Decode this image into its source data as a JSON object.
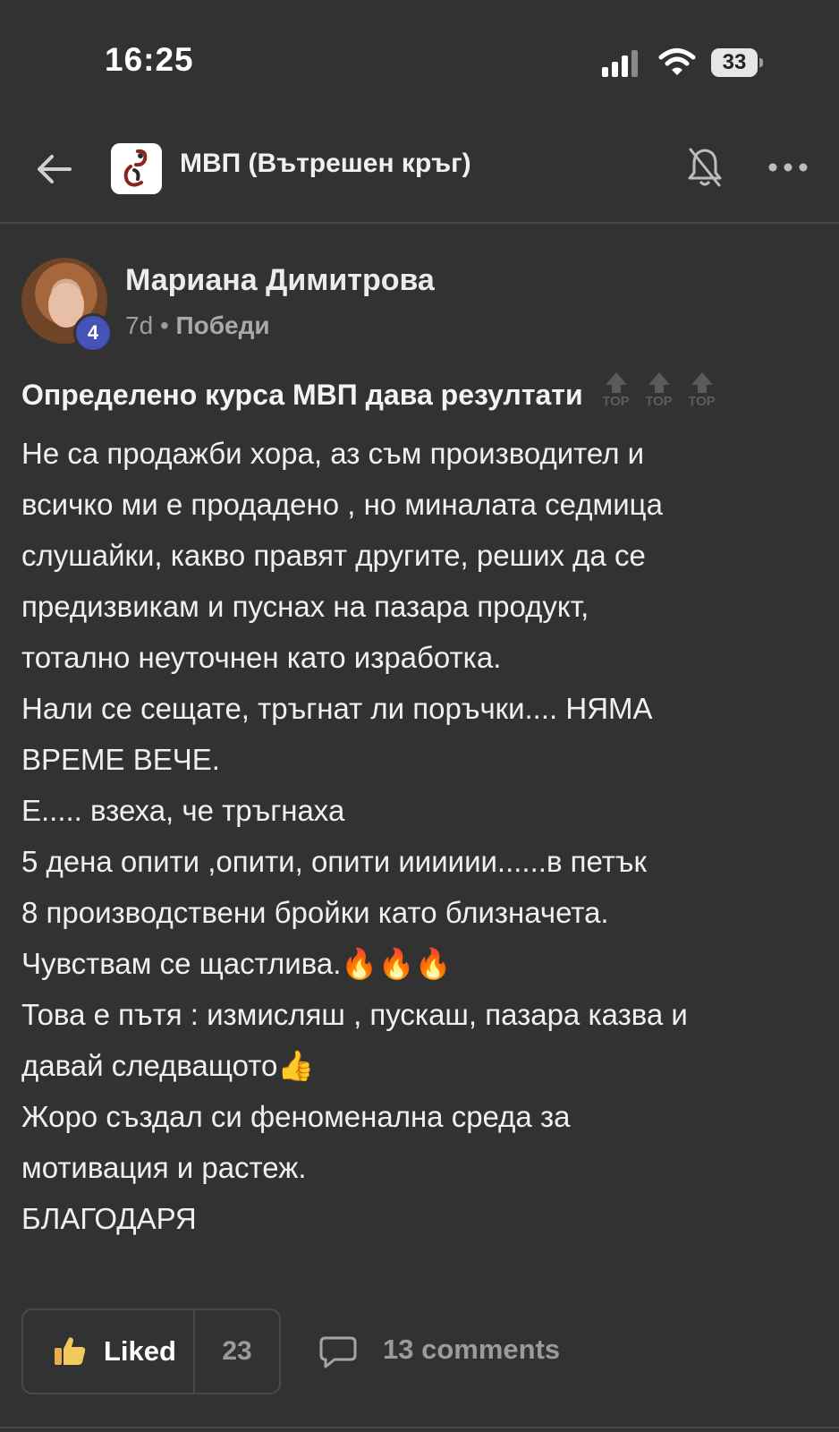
{
  "status_bar": {
    "time": "16:25",
    "battery": "33"
  },
  "header": {
    "group_name": "МВП (Вътрешен кръг)"
  },
  "post": {
    "author": "Мариана Димитрова",
    "level": "4",
    "age": "7d",
    "separator": "•",
    "category": "Победи",
    "title": "Определено курса МВП дава резултати",
    "top_badge_text": "TOP",
    "body_lines": [
      "Не са продажби хора, аз съм производител и",
      "всичко ми е продадено , но миналата седмица",
      "слушайки, какво правят другите, реших да се",
      "предизвикам и пуснах на пазара продукт,",
      "тотално неуточнен като изработка.",
      "Нали се сещате, тръгнат ли поръчки.... НЯМА",
      "ВРЕМЕ ВЕЧЕ.",
      "Е..... взеха, че тръгнаха",
      "5 дена опити ,опити, опити ииииии......в петък",
      "8 производствени бройки като близначета.",
      "Чувствам се щастлива.🔥🔥🔥",
      "Това е пътя : измисляш , пускаш, пазара казва и",
      "давай следващото👍",
      "Жоро създал си феноменална среда за",
      "мотивация и растеж.",
      "БЛАГОДАРЯ"
    ]
  },
  "actions": {
    "liked_label": "Liked",
    "like_count": "23",
    "comments_label": "13 comments"
  },
  "icons": [
    "back-arrow-icon",
    "group-logo-icon",
    "bell-off-icon",
    "more-icon",
    "thumbs-up-icon",
    "comment-icon",
    "top-icon"
  ],
  "colors": {
    "background": "#323232",
    "badge": "#4552b7",
    "muted": "#9b9b9b"
  }
}
